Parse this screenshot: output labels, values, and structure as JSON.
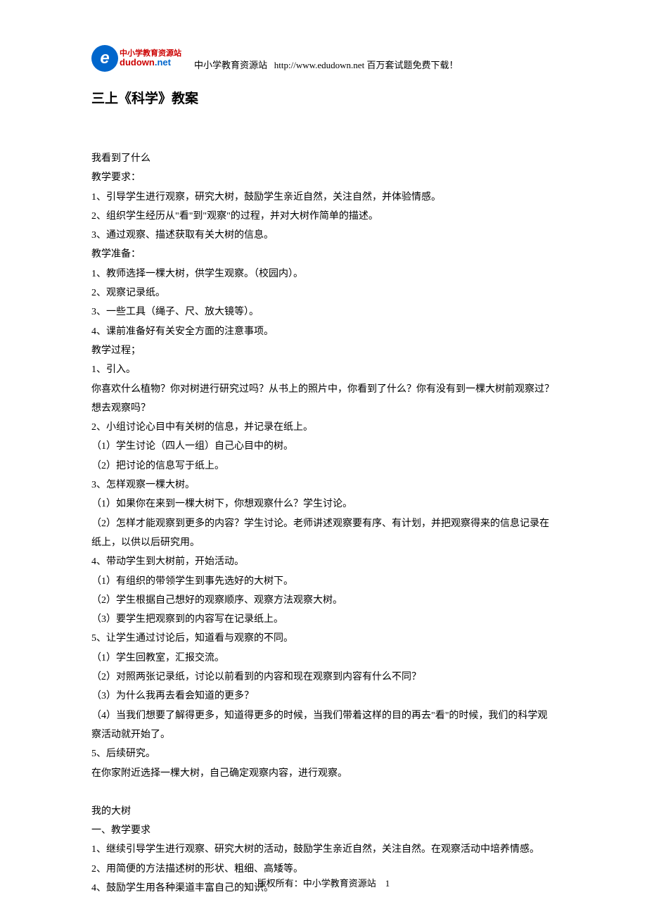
{
  "header": {
    "logo_letter": "e",
    "logo_cn": "中小学教育资源站",
    "logo_en_main": "dudown",
    "logo_en_suffix": ".net",
    "site_name": "中小学教育资源站",
    "site_url": "http://www.edudown.net",
    "tagline": "百万套试题免费下载！"
  },
  "title": "三上《科学》教案",
  "body": {
    "l01": "我看到了什么",
    "l02": "教学要求：",
    "l03": "1、引导学生进行观察，研究大树，鼓励学生亲近自然，关注自然，并体验情感。",
    "l04": "2、组织学生经历从\"看\"到\"观察\"的过程，并对大树作简单的描述。",
    "l05": "3、通过观察、描述获取有关大树的信息。",
    "l06": "教学准备：",
    "l07": "1、教师选择一棵大树，供学生观察。（校园内）。",
    "l08": "2、观察记录纸。",
    "l09": "3、一些工具（绳子、尺、放大镜等）。",
    "l10": "4、课前准备好有关安全方面的注意事项。",
    "l11": "教学过程；",
    "l12": "1、引入。",
    "l13": "你喜欢什么植物？你对树进行研究过吗？从书上的照片中，你看到了什么？你有没有到一棵大树前观察过？想去观察吗？",
    "l14": "2、小组讨论心目中有关树的信息，并记录在纸上。",
    "l15": "（1）学生讨论（四人一组）自己心目中的树。",
    "l16": "（2）把讨论的信息写于纸上。",
    "l17": "3、怎样观察一棵大树。",
    "l18": "（1）如果你在来到一棵大树下，你想观察什么？学生讨论。",
    "l19": "（2）怎样才能观察到更多的内容？学生讨论。老师讲述观察要有序、有计划，并把观察得来的信息记录在纸上，以供以后研究用。",
    "l20": "4、带动学生到大树前，开始活动。",
    "l21": "（1）有组织的带领学生到事先选好的大树下。",
    "l22": "（2）学生根据自己想好的观察顺序、观察方法观察大树。",
    "l23": "（3）要学生把观察到的内容写在记录纸上。",
    "l24": "5、让学生通过讨论后，知道看与观察的不同。",
    "l25": "（1）学生回教室，汇报交流。",
    "l26": "（2）对照两张记录纸，讨论以前看到的内容和现在观察到内容有什么不同？",
    "l27": "（3）为什么我再去看会知道的更多？",
    "l28": "（4）当我们想要了解得更多，知道得更多的时候，当我们带着这样的目的再去\"看\"的时候，我们的科学观察活动就开始了。",
    "l29": "5、后续研究。",
    "l30": "在你家附近选择一棵大树，自己确定观察内容，进行观察。",
    "l31": "我的大树",
    "l32": "一、教学要求",
    "l33": "1、继续引导学生进行观察、研究大树的活动，鼓励学生亲近自然，关注自然。在观察活动中培养情感。",
    "l34": "2、用简便的方法描述树的形状、粗细、高矮等。",
    "l35": "4、鼓励学生用各种渠道丰富自己的知识。"
  },
  "footer": {
    "copyright": "版权所有：中小学教育资源站",
    "page_num": "1"
  }
}
